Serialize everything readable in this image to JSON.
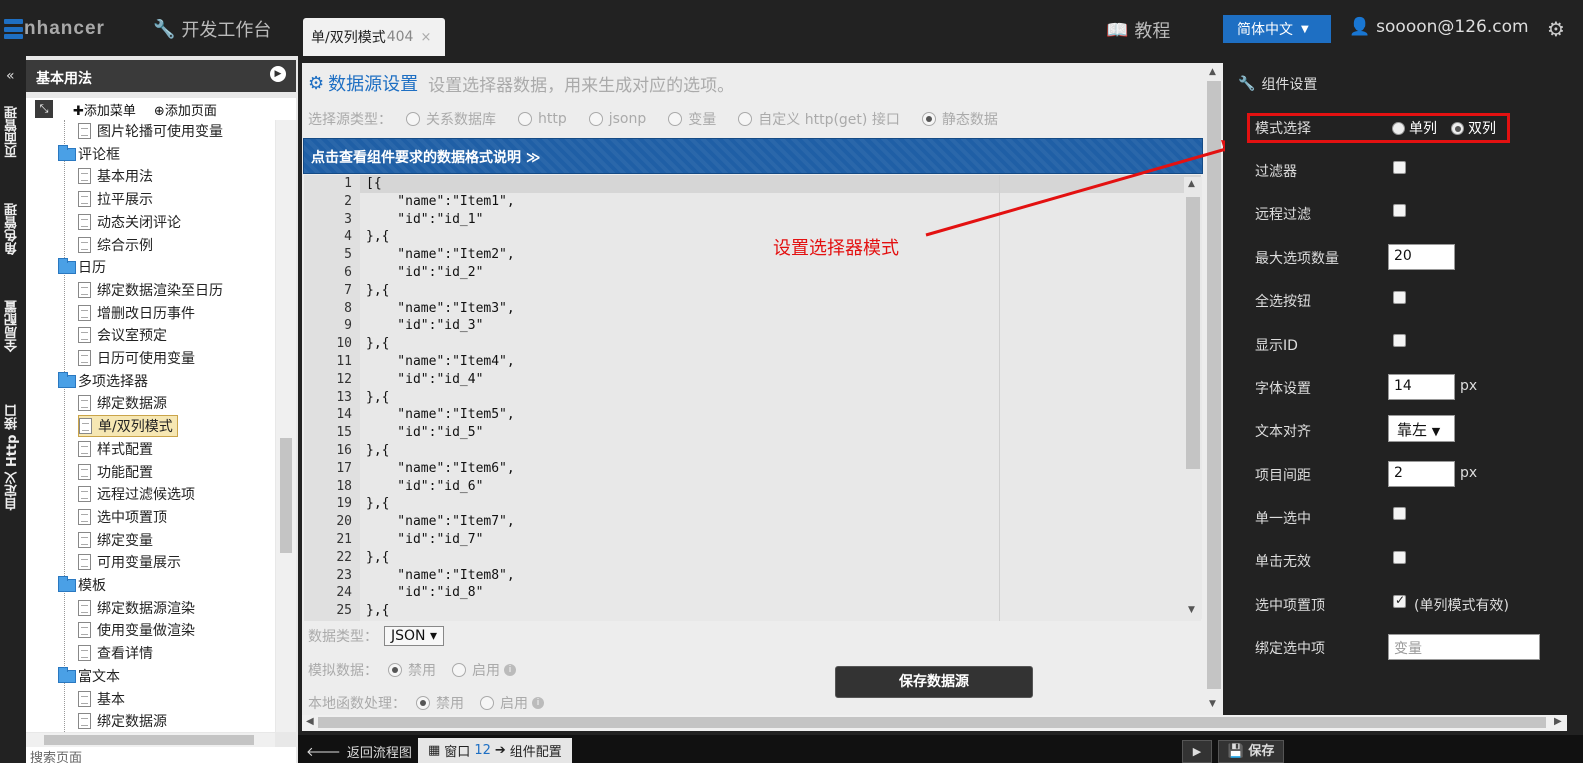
{
  "topbar": {
    "logo_text": "nhancer",
    "dev_workbench": "开发工作台",
    "tab_label": "单/双列模式",
    "tab_count": "404",
    "tab_close": "×",
    "tutorial": "教程",
    "language": "简体中文",
    "user_email": "soooon@126.com"
  },
  "vertical_tabs": [
    "页面管理",
    "角色管理",
    "全局配置",
    "自定义 Http 接口"
  ],
  "sidebar": {
    "title": "基本用法",
    "add_menu": "添加菜单",
    "add_page": "添加页面",
    "tree": [
      {
        "label": "图片轮播可使用变量",
        "type": "page",
        "level": 2
      },
      {
        "label": "评论框",
        "type": "folder",
        "level": 1
      },
      {
        "label": "基本用法",
        "type": "page",
        "level": 2
      },
      {
        "label": "拉平展示",
        "type": "page",
        "level": 2
      },
      {
        "label": "动态关闭评论",
        "type": "page",
        "level": 2
      },
      {
        "label": "综合示例",
        "type": "page",
        "level": 2
      },
      {
        "label": "日历",
        "type": "folder",
        "level": 1
      },
      {
        "label": "绑定数据渲染至日历",
        "type": "page",
        "level": 2
      },
      {
        "label": "增删改日历事件",
        "type": "page",
        "level": 2
      },
      {
        "label": "会议室预定",
        "type": "page",
        "level": 2
      },
      {
        "label": "日历可使用变量",
        "type": "page",
        "level": 2
      },
      {
        "label": "多项选择器",
        "type": "folder",
        "level": 1
      },
      {
        "label": "绑定数据源",
        "type": "page",
        "level": 2
      },
      {
        "label": "单/双列模式",
        "type": "page",
        "level": 2,
        "selected": true
      },
      {
        "label": "样式配置",
        "type": "page",
        "level": 2
      },
      {
        "label": "功能配置",
        "type": "page",
        "level": 2
      },
      {
        "label": "远程过滤候选项",
        "type": "page",
        "level": 2
      },
      {
        "label": "选中项置顶",
        "type": "page",
        "level": 2
      },
      {
        "label": "绑定变量",
        "type": "page",
        "level": 2
      },
      {
        "label": "可用变量展示",
        "type": "page",
        "level": 2
      },
      {
        "label": "模板",
        "type": "folder",
        "level": 1
      },
      {
        "label": "绑定数据源渲染",
        "type": "page",
        "level": 2
      },
      {
        "label": "使用变量做渲染",
        "type": "page",
        "level": 2
      },
      {
        "label": "查看详情",
        "type": "page",
        "level": 2
      },
      {
        "label": "富文本",
        "type": "folder",
        "level": 1
      },
      {
        "label": "基本",
        "type": "page",
        "level": 2
      },
      {
        "label": "绑定数据源",
        "type": "page",
        "level": 2
      }
    ],
    "search_placeholder": "搜索页面"
  },
  "main": {
    "title": "数据源设置",
    "subtitle": "设置选择器数据，用来生成对应的选项。",
    "source_type_label": "选择源类型：",
    "source_types": [
      "关系数据库",
      "http",
      "jsonp",
      "变量",
      "自定义 http(get) 接口",
      "静态数据"
    ],
    "source_type_selected": "静态数据",
    "banner": "点击查看组件要求的数据格式说明 ≫",
    "code_lines": [
      "[{",
      "    \"name\":\"Item1\",",
      "    \"id\":\"id_1\"",
      "},{",
      "    \"name\":\"Item2\",",
      "    \"id\":\"id_2\"",
      "},{",
      "    \"name\":\"Item3\",",
      "    \"id\":\"id_3\"",
      "},{",
      "    \"name\":\"Item4\",",
      "    \"id\":\"id_4\"",
      "},{",
      "    \"name\":\"Item5\",",
      "    \"id\":\"id_5\"",
      "},{",
      "    \"name\":\"Item6\",",
      "    \"id\":\"id_6\"",
      "},{",
      "    \"name\":\"Item7\",",
      "    \"id\":\"id_7\"",
      "},{",
      "    \"name\":\"Item8\",",
      "    \"id\":\"id_8\"",
      "},{"
    ],
    "data_type_label": "数据类型：",
    "data_type_value": "JSON",
    "mock_label": "模拟数据：",
    "local_fn_label": "本地函数处理：",
    "disable_label": "禁用",
    "enable_label": "启用",
    "save_button": "保存数据源",
    "annotation": "设置选择器模式"
  },
  "bottombar": {
    "back": "返回流程图",
    "window_label": "窗口",
    "window_num": "12",
    "window_tail": "组件配置",
    "save": "保存"
  },
  "component_settings": {
    "title": "组件设置",
    "mode_label": "模式选择",
    "mode_single": "单列",
    "mode_double": "双列",
    "mode_selected": "双列",
    "filter_label": "过滤器",
    "remote_filter_label": "远程过滤",
    "max_options_label": "最大选项数量",
    "max_options_value": "20",
    "select_all_label": "全选按钮",
    "show_id_label": "显示ID",
    "font_label": "字体设置",
    "font_value": "14",
    "unit_px": "px",
    "align_label": "文本对齐",
    "align_value": "靠左",
    "spacing_label": "项目间距",
    "spacing_value": "2",
    "single_select_label": "单一选中",
    "click_disabled_label": "单击无效",
    "pin_selected_label": "选中项置顶",
    "pin_selected_note": "(单列模式有效)",
    "bind_label": "绑定选中项",
    "bind_placeholder": "变量",
    "checks": {
      "filter": false,
      "remote_filter": false,
      "select_all": false,
      "show_id": false,
      "single_select": false,
      "click_disabled": false,
      "pin_selected": true
    }
  },
  "colors": {
    "accent": "#1e6fc3",
    "highlight": "#e31111",
    "banner": "#1f5fa6"
  }
}
